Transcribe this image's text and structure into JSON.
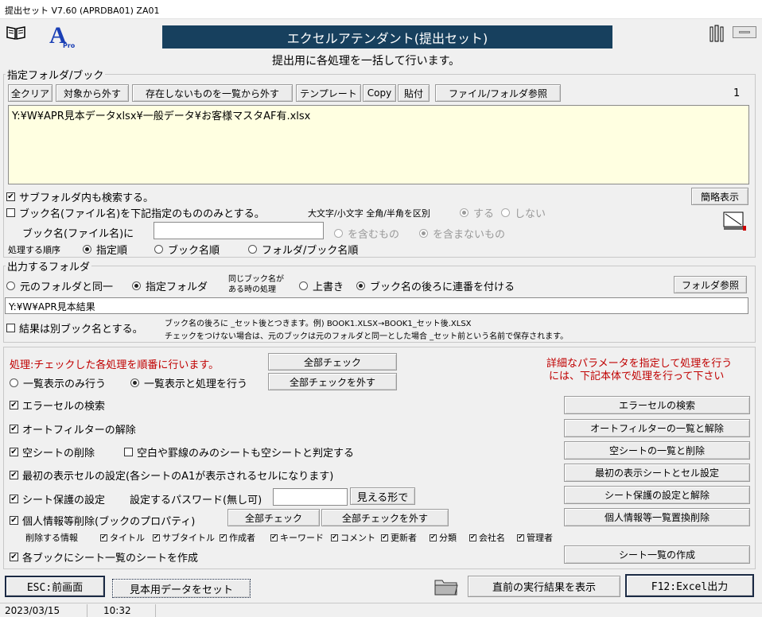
{
  "window": {
    "title": "提出セット V7.60 (APRDBA01)  ZA01"
  },
  "header": {
    "banner": "エクセルアテンダント(提出セット)",
    "subtitle": "提出用に各処理を一括して行います。",
    "logo_letter": "A",
    "logo_sub": "Pro"
  },
  "folder_book": {
    "legend": "指定フォルダ/ブック",
    "buttons": [
      "全クリア",
      "対象から外す",
      "存在しないものを一覧から外す",
      "テンプレート",
      "Copy",
      "貼付",
      "ファイル/フォルダ参照"
    ],
    "count": "1",
    "path_list": "Y:¥W¥APR見本データxlsx¥一般データ¥お客様マスタAF有.xlsx",
    "include_subfolders": {
      "label": "サブフォルダ内も検索する。",
      "checked": true
    },
    "simple_view_button": "簡略表示",
    "filter_by_name": {
      "label": "ブック名(ファイル名)を下記指定のもののみとする。",
      "checked": false
    },
    "case_label": "大文字/小文字 全角/半角を区別",
    "case_options": [
      "する",
      "しない"
    ],
    "name_label": "ブック名(ファイル名)に",
    "name_value": "",
    "match_options": [
      "を含むもの",
      "を含まないもの"
    ],
    "order_label": "処理する順序",
    "order_options": [
      "指定順",
      "ブック名順",
      "フォルダ/ブック名順"
    ]
  },
  "output": {
    "legend": "出力するフォルダ",
    "dest_options": [
      "元のフォルダと同一",
      "指定フォルダ"
    ],
    "same_name_label_1": "同じブック名が",
    "same_name_label_2": "ある時の処理",
    "same_name_options": [
      "上書き",
      "ブック名の後ろに連番を付ける"
    ],
    "folder_ref_button": "フォルダ参照",
    "folder_path": "Y:¥W¥APR見本結果",
    "separate_name": {
      "label": "結果は別ブック名とする。",
      "checked": false
    },
    "note_1": "ブック名の後ろに _セット後とつきます。例) BOOK1.XLSX→BOOK1_セット後.XLSX",
    "note_2": "チェックをつけない場合は、元のブックは元のフォルダと同一とした場合 _セット前という名前で保存されます。"
  },
  "process": {
    "note": "処理:チェックした各処理を順番に行います。",
    "check_all": "全部チェック",
    "uncheck_all": "全部チェックを外す",
    "mode_options": [
      "一覧表示のみ行う",
      "一覧表示と処理を行う"
    ],
    "detail_note_1": "詳細なパラメータを指定して処理を行う",
    "detail_note_2": "には、下記本体で処理を行って下さい",
    "items": [
      {
        "label": "エラーセルの検索",
        "checked": true,
        "button": "エラーセルの検索"
      },
      {
        "label": "オートフィルターの解除",
        "checked": true,
        "button": "オートフィルターの一覧と解除"
      },
      {
        "label": "空シートの削除",
        "checked": true,
        "button": "空シートの一覧と削除"
      },
      {
        "label": "最初の表示セルの設定(各シートのA1が表示されるセルになります)",
        "checked": true,
        "button": "最初の表示シートとセル設定"
      },
      {
        "label": "シート保護の設定",
        "checked": true,
        "button": "シート保護の設定と解除"
      },
      {
        "label": "個人情報等削除(ブックのプロパティ)",
        "checked": true,
        "button": "個人情報等一覧置換削除"
      },
      {
        "label": "各ブックにシート一覧のシートを作成",
        "checked": true,
        "button": "シート一覧の作成"
      }
    ],
    "blank_sheet_option": {
      "label": "空白や罫線のみのシートも空シートと判定する",
      "checked": false
    },
    "password_label": "設定するパスワード(無し可)",
    "password_value": "",
    "show_password_button": "見える形で",
    "personal_check_all": "全部チェック",
    "personal_uncheck_all": "全部チェックを外す",
    "delete_info_label": "削除する情報",
    "delete_info_items": [
      {
        "label": "タイトル",
        "checked": true
      },
      {
        "label": "サブタイトル",
        "checked": true
      },
      {
        "label": "作成者",
        "checked": true
      },
      {
        "label": "キーワード",
        "checked": true
      },
      {
        "label": "コメント",
        "checked": true
      },
      {
        "label": "更新者",
        "checked": true
      },
      {
        "label": "分類",
        "checked": true
      },
      {
        "label": "会社名",
        "checked": true
      },
      {
        "label": "管理者",
        "checked": true
      }
    ]
  },
  "footer": {
    "esc_button": "ESC:前画面",
    "sample_button": "見本用データをセット",
    "last_result_button": "直前の実行結果を表示",
    "f12_button": "F12:Excel出力"
  },
  "status": {
    "date": "2023/03/15",
    "time": "10:32"
  }
}
